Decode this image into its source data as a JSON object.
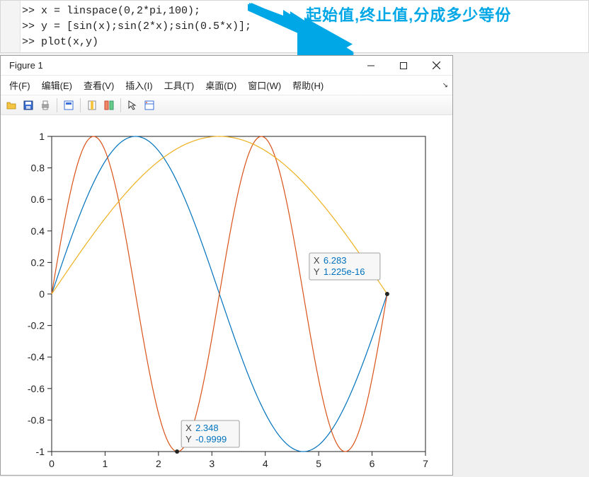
{
  "editor": {
    "lines": [
      ">> x = linspace(0,2*pi,100);",
      ">> y = [sin(x);sin(2*x);sin(0.5*x)];",
      ">> plot(x,y)"
    ]
  },
  "annotation": {
    "text": "起始值,终止值,分成多少等份"
  },
  "figure": {
    "title": "Figure 1",
    "menu": [
      "件(F)",
      "编辑(E)",
      "查看(V)",
      "插入(I)",
      "工具(T)",
      "桌面(D)",
      "窗口(W)",
      "帮助(H)"
    ],
    "datatips": [
      {
        "x_label": "X",
        "x_val": "6.283",
        "y_label": "Y",
        "y_val": "1.225e-16"
      },
      {
        "x_label": "X",
        "x_val": "2.348",
        "y_label": "Y",
        "y_val": "-0.9999"
      }
    ]
  },
  "chart_data": {
    "type": "line",
    "xlim": [
      0,
      7
    ],
    "ylim": [
      -1,
      1
    ],
    "xticks": [
      0,
      1,
      2,
      3,
      4,
      5,
      6,
      7
    ],
    "yticks": [
      -1,
      -0.8,
      -0.6,
      -0.4,
      -0.2,
      0,
      0.2,
      0.4,
      0.6,
      0.8,
      1
    ],
    "x": "linspace(0, 6.283, 100)",
    "series": [
      {
        "name": "sin(x)",
        "color": "#0072bd",
        "expr": "sin(x)"
      },
      {
        "name": "sin(2x)",
        "color": "#d95319",
        "expr": "sin(2x)"
      },
      {
        "name": "sin(0.5x)",
        "color": "#edb120",
        "expr": "sin(0.5x)"
      }
    ],
    "datatips": [
      {
        "series": 0,
        "x": 6.283,
        "y": 1.225e-16
      },
      {
        "series": 1,
        "x": 2.348,
        "y": -0.9999
      }
    ]
  }
}
